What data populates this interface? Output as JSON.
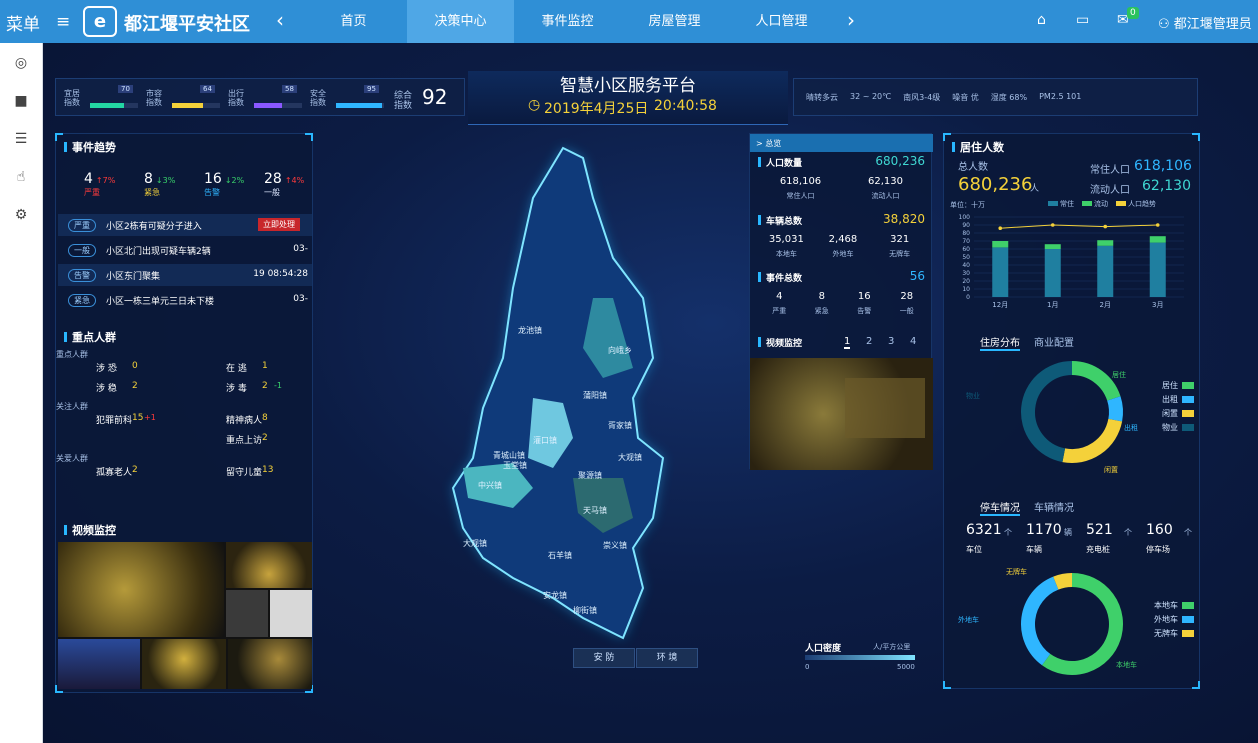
{
  "topbar": {
    "menu_label": "菜单",
    "app_title": "都江堰平安社区",
    "nav": [
      "首页",
      "决策中心",
      "事件监控",
      "房屋管理",
      "人口管理"
    ],
    "active_index": 1,
    "user": "都江堰管理员",
    "mail_badge": "0"
  },
  "header": {
    "title": "智慧小区服务平台",
    "date": "2019年4月25日",
    "time": "20:40:58",
    "indices": [
      {
        "label1": "宜居",
        "label2": "指数",
        "value": "70",
        "color": "#23d7a3",
        "fill": 0.7
      },
      {
        "label1": "市容",
        "label2": "指数",
        "value": "64",
        "color": "#f4d13a",
        "fill": 0.64
      },
      {
        "label1": "出行",
        "label2": "指数",
        "value": "58",
        "color": "#8a58ff",
        "fill": 0.58
      },
      {
        "label1": "安全",
        "label2": "指数",
        "value": "95",
        "color": "#2fb6ff",
        "fill": 0.95
      }
    ],
    "composite_label1": "综合",
    "composite_label2": "指数",
    "composite_value": "92",
    "weather": [
      "晴转多云",
      "32 ~ 20℃",
      "南风3-4级",
      "噪音 优",
      "湿度 68%",
      "PM2.5 101"
    ]
  },
  "events": {
    "title": "事件趋势",
    "stats": [
      {
        "count": "4",
        "change": "7%",
        "dir": "up",
        "label": "严重",
        "color": "#ff3b3b"
      },
      {
        "count": "8",
        "change": "3%",
        "dir": "down",
        "label": "紧急",
        "color": "#f4d13a"
      },
      {
        "count": "16",
        "change": "2%",
        "dir": "down",
        "label": "告警",
        "color": "#2fb6ff"
      },
      {
        "count": "28",
        "change": "4%",
        "dir": "up",
        "label": "一般",
        "color": "#dfe8ff"
      }
    ],
    "list": [
      {
        "tag": "严重",
        "text": "小区2栋有可疑分子进入",
        "action": "立即处理",
        "time": ""
      },
      {
        "tag": "一般",
        "text": "小区北门出现可疑车辆2辆",
        "action": "",
        "time": "03-"
      },
      {
        "tag": "告警",
        "text": "小区东门聚集",
        "action": "",
        "time": "19 08:54:28"
      },
      {
        "tag": "紧急",
        "text": "小区一栋三单元三日未下楼",
        "action": "",
        "time": "03-"
      }
    ]
  },
  "key_people": {
    "title": "重点人群",
    "groups": [
      {
        "name": "重点人群",
        "rows": [
          [
            {
              "label": "涉 恐",
              "value": "0"
            },
            {
              "label": "在 逃",
              "value": "1"
            }
          ],
          [
            {
              "label": "涉 稳",
              "value": "2"
            },
            {
              "label": "涉 毒",
              "value": "2",
              "change": "-1"
            }
          ]
        ]
      },
      {
        "name": "关注人群",
        "rows": [
          [
            {
              "label": "犯罪前科",
              "value": "15",
              "change": "+1"
            },
            {
              "label": "精神病人",
              "value": "8"
            }
          ],
          [
            {
              "label": "",
              "value": ""
            },
            {
              "label": "重点上访",
              "value": "2"
            }
          ]
        ]
      },
      {
        "name": "关爱人群",
        "rows": [
          [
            {
              "label": "孤寡老人",
              "value": "2"
            },
            {
              "label": "留守儿童",
              "value": "13"
            }
          ]
        ]
      }
    ]
  },
  "video_left": {
    "title": "视频监控"
  },
  "map": {
    "regions": [
      "龙池镇",
      "向峨乡",
      "蒲阳镇",
      "灌口镇",
      "青城山镇",
      "胥家镇",
      "大观镇",
      "玉堂镇",
      "中兴镇",
      "聚源镇",
      "天马镇",
      "崇义镇",
      "石羊镇",
      "安龙镇",
      "柳街镇",
      "大观镇"
    ],
    "buttons": [
      "安 防",
      "环 境"
    ],
    "legend_title": "人口密度",
    "legend_unit": "人/平方公里",
    "legend_min": "0",
    "legend_max": "5000"
  },
  "stats": {
    "header": "> 总览",
    "population": {
      "label": "人口数量",
      "value": "680,236",
      "items": [
        {
          "v": "618,106",
          "l": "常住人口"
        },
        {
          "v": "62,130",
          "l": "流动人口"
        }
      ]
    },
    "vehicles": {
      "label": "车辆总数",
      "value": "38,820",
      "items": [
        {
          "v": "35,031",
          "l": "本地车"
        },
        {
          "v": "2,468",
          "l": "外地车"
        },
        {
          "v": "321",
          "l": "无牌车"
        }
      ]
    },
    "events": {
      "label": "事件总数",
      "value": "56",
      "items": [
        {
          "v": "4",
          "l": "严重"
        },
        {
          "v": "8",
          "l": "紧急"
        },
        {
          "v": "16",
          "l": "告警"
        },
        {
          "v": "28",
          "l": "一般"
        }
      ]
    },
    "video": {
      "label": "视频监控",
      "pages": [
        "1",
        "2",
        "3",
        "4"
      ]
    }
  },
  "residents": {
    "title": "居住人数",
    "total_label": "总人数",
    "total": "680,236",
    "unit": "人",
    "resident_label": "常住人口",
    "resident": "618,106",
    "floating_label": "流动人口",
    "floating": "62,130",
    "tabs": [
      "住房分布",
      "商业配置"
    ],
    "parking_tabs": [
      "停车情况",
      "车辆情况"
    ],
    "housing_legend": [
      "居住",
      "出租",
      "闲置",
      "物业"
    ],
    "housing_colors": [
      "#3fd06a",
      "#2fb6ff",
      "#f4d13a",
      "#0e5a78"
    ],
    "parking_stats": [
      {
        "v": "6321",
        "u": "个",
        "l": "车位"
      },
      {
        "v": "1170",
        "u": "辆",
        "l": "车辆"
      },
      {
        "v": "521",
        "u": "个",
        "l": "充电桩"
      },
      {
        "v": "160",
        "u": "个",
        "l": "停车场"
      }
    ],
    "car_legend": [
      "本地车",
      "外地车",
      "无牌车"
    ],
    "car_colors": [
      "#3fd06a",
      "#2fb6ff",
      "#f4d13a"
    ]
  },
  "chart_data": [
    {
      "type": "bar",
      "title": "",
      "unit_label": "单位：十万",
      "categories": [
        "12月",
        "1月",
        "2月",
        "3月"
      ],
      "series": [
        {
          "name": "常住",
          "values": [
            62,
            60,
            64,
            68
          ]
        },
        {
          "name": "流动",
          "values": [
            8,
            6,
            7,
            8
          ]
        },
        {
          "name": "人口趋势",
          "values": [
            86,
            90,
            88,
            90
          ]
        }
      ],
      "ylim": [
        0,
        100
      ],
      "yticks": [
        0,
        10,
        20,
        30,
        40,
        50,
        60,
        70,
        80,
        90,
        100
      ]
    },
    {
      "type": "pie",
      "categories": [
        "居住",
        "出租",
        "闲置",
        "物业"
      ],
      "values": [
        20,
        8,
        25,
        47
      ]
    },
    {
      "type": "pie",
      "categories": [
        "本地车",
        "外地车",
        "无牌车"
      ],
      "values": [
        60,
        34,
        6
      ]
    }
  ]
}
